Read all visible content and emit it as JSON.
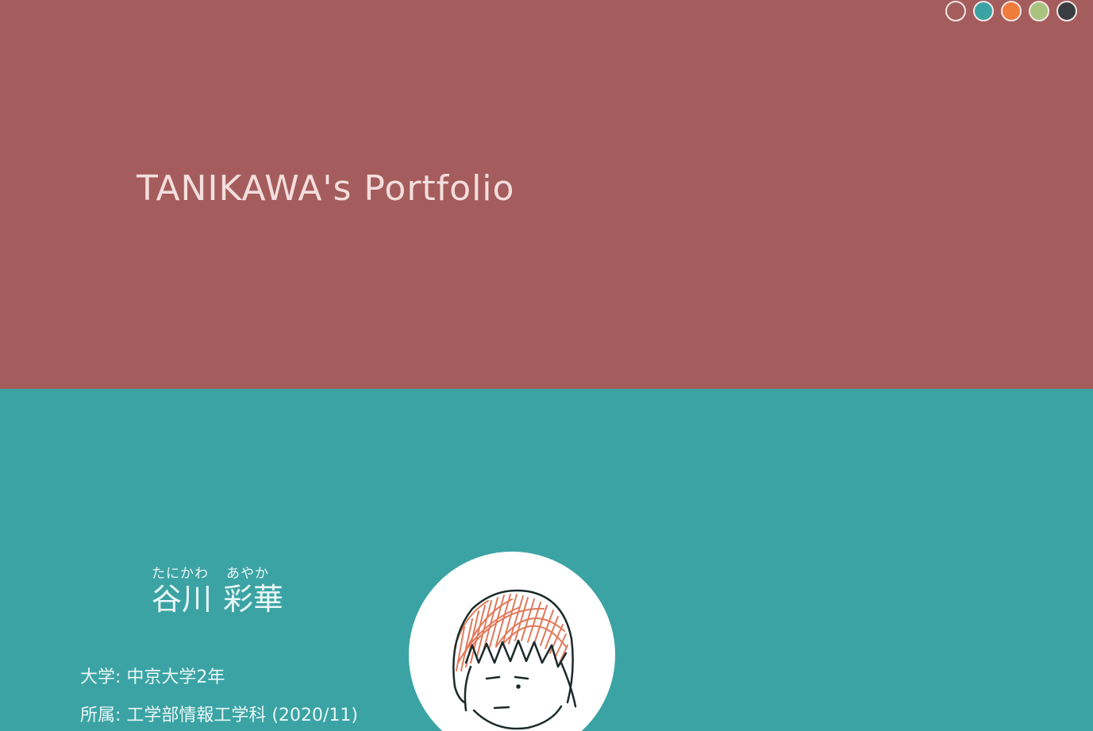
{
  "header": {
    "title": "TANIKAWA's Portfolio",
    "theme_dots": [
      {
        "name": "rose",
        "color": "#a45d5c"
      },
      {
        "name": "teal",
        "color": "#3ca3a4"
      },
      {
        "name": "orange",
        "color": "#ef7b3c"
      },
      {
        "name": "green",
        "color": "#a9c27e"
      },
      {
        "name": "dark",
        "color": "#3a3d42"
      }
    ]
  },
  "profile": {
    "ruby_family": "たにかわ",
    "ruby_given": "あやか",
    "name_family": "谷川",
    "name_given": "彩華",
    "university": "大学: 中京大学2年",
    "affiliation": "所属: 工学部情報工学科 (2020/11)",
    "avatar": "hand-drawn-face-icon"
  },
  "colors": {
    "hero_bg": "#a45d5c",
    "profile_bg": "#3ca3a4",
    "title_text": "#f4dedd",
    "profile_text": "#e9f7f7",
    "hair": "#e0795a"
  }
}
